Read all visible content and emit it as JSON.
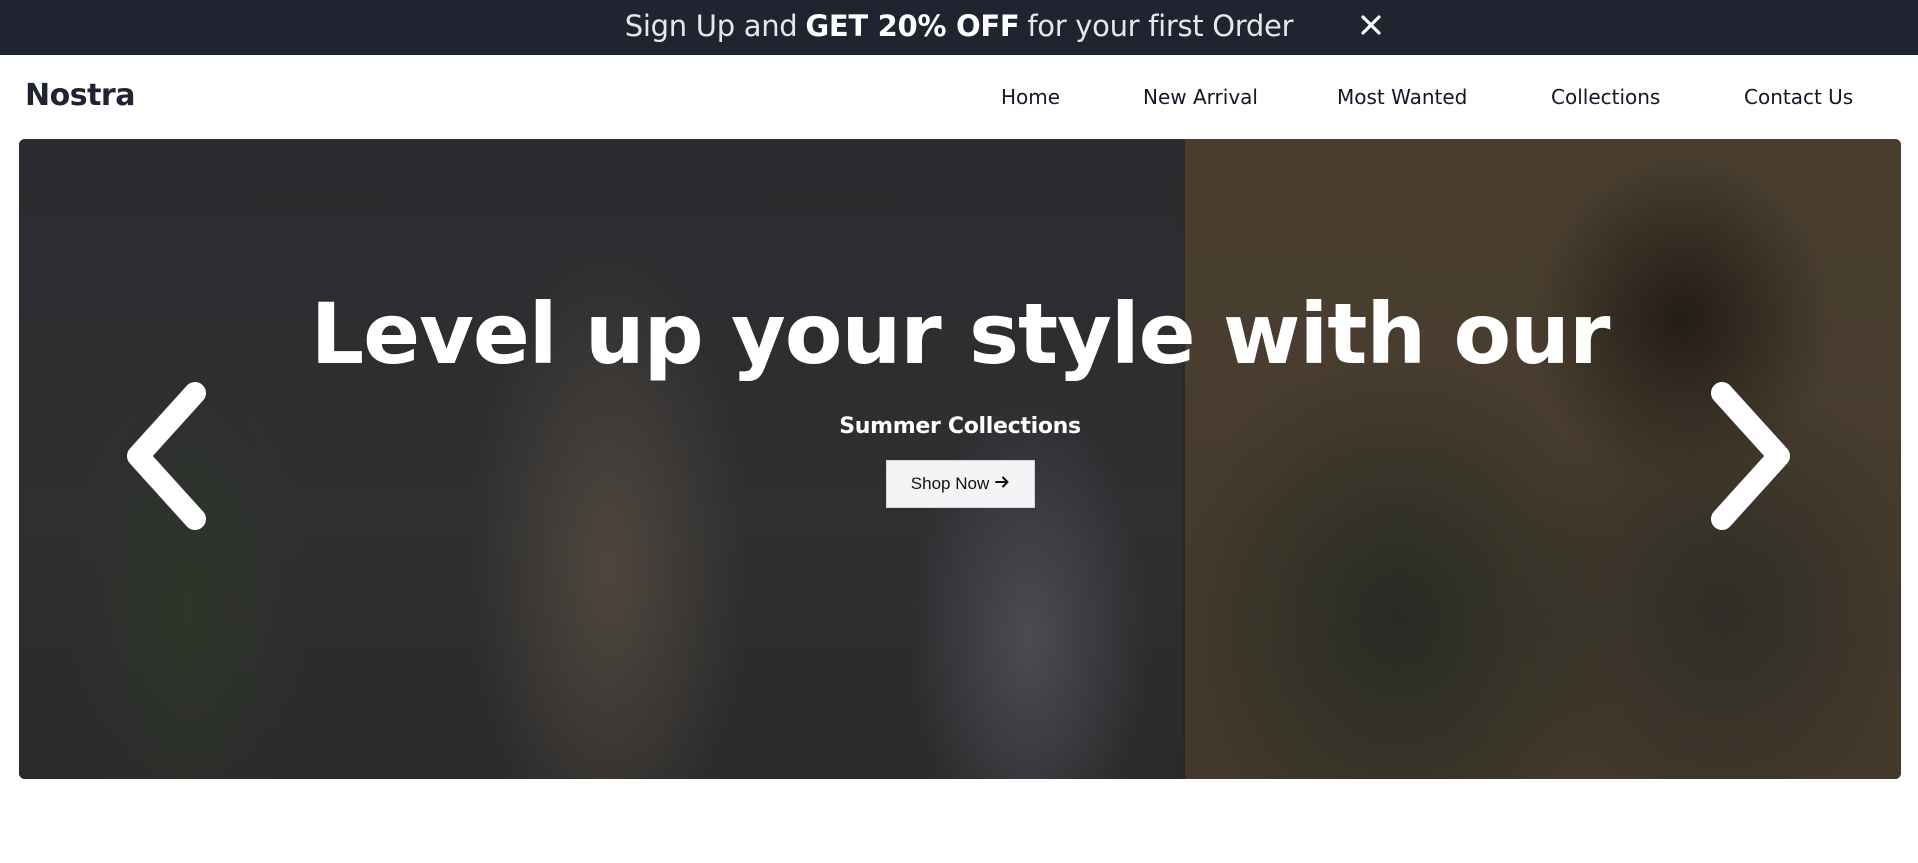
{
  "promo": {
    "text_before": "Sign Up and",
    "text_bold": "GET 20% OFF",
    "text_after": "for your first Order",
    "close_icon": "close-icon"
  },
  "nav": {
    "logo": "Nostra",
    "links": [
      "Home",
      "New Arrival",
      "Most Wanted",
      "Collections",
      "Contact Us"
    ]
  },
  "hero": {
    "title": "Level up your style with our",
    "subtitle": "Summer Collections",
    "cta_label": "Shop Now",
    "cta_icon": "arrow-right-icon",
    "prev_icon": "chevron-left-icon",
    "next_icon": "chevron-right-icon"
  },
  "colors": {
    "promo_bg": "#1f2430",
    "text_dark": "#1f2430",
    "hero_overlay": "#2a2b2e",
    "button_bg": "#f3f4f6"
  }
}
